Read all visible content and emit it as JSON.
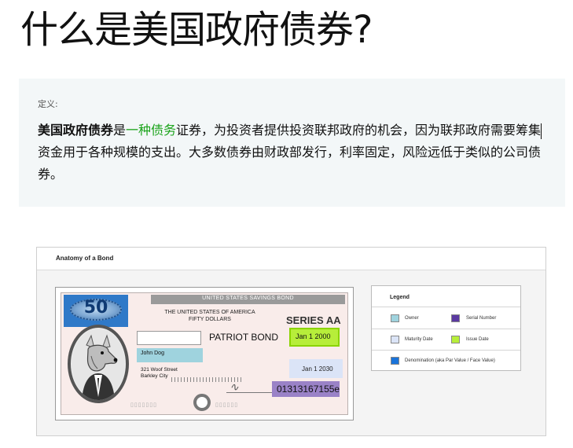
{
  "page": {
    "title": "什么是美国政府债券?"
  },
  "definition": {
    "label": "定义:",
    "term": "美国政府债券",
    "connector": "是",
    "link_text": "一种债务",
    "body": "证券，为投资者提供投资联邦政府的机会，因为联邦政府需要筹集资金用于各种规模的支出。大多数债券由财政部发行，利率固定，风险远低于类似的公司债券。"
  },
  "figure": {
    "title": "Anatomy of a Bond",
    "bond": {
      "header": "UNITED STATES SAVINGS BOND",
      "denomination": "50",
      "issuer_line1": "THE UNITED STATES OF AMERICA",
      "issuer_line2": "FIFTY DOLLARS",
      "series": "SERIES AA",
      "bond_name": "PATRIOT BOND",
      "issue_date": "Jan 1 2000",
      "maturity_date": "Jan 1 2030",
      "owner_name": "John Dog",
      "address_line1": "321 Woof Street",
      "address_line2": "Barkley City",
      "serial_number": "01313167155e"
    },
    "legend": {
      "title": "Legend",
      "items": [
        {
          "label": "Owner",
          "color": "#9fd3de"
        },
        {
          "label": "Serial Number",
          "color": "#5b3aa1"
        },
        {
          "label": "Maturity Date",
          "color": "#dbe4f7"
        },
        {
          "label": "Issue Date",
          "color": "#b7ee3a"
        },
        {
          "label": "Denomination (aka Par Value / Face Value)",
          "color": "#1a73d9"
        }
      ]
    }
  }
}
